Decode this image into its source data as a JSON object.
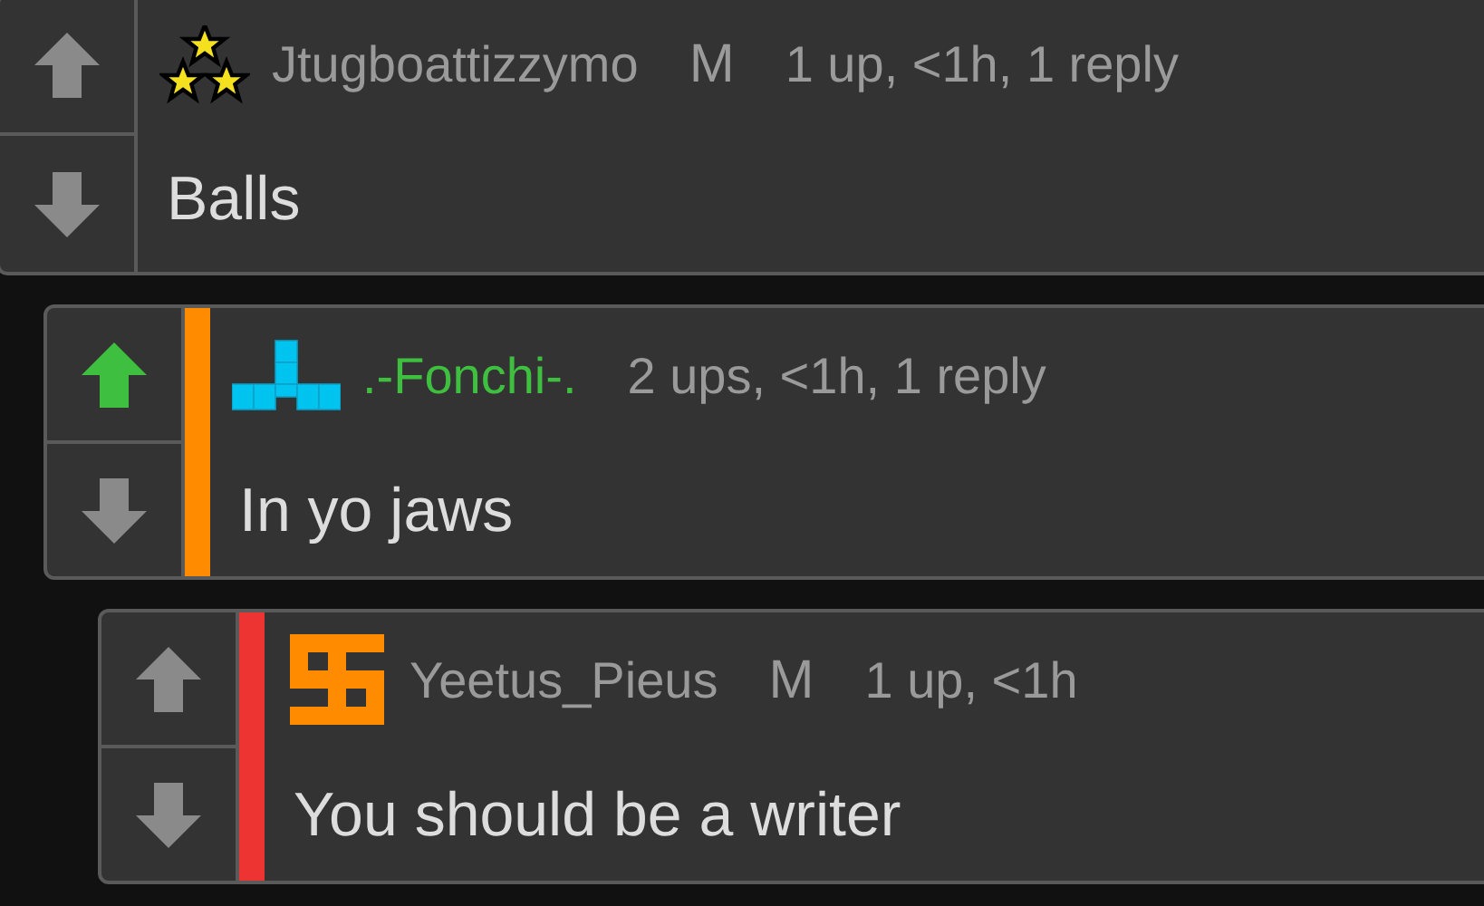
{
  "comments": [
    {
      "user": "Jtugboattizzymo",
      "user_highlighted": false,
      "mod_badge": "M",
      "meta": "1 up, <1h, 1 reply",
      "body": "Balls",
      "upvoted": false,
      "downvoted": false,
      "children": [
        {
          "user": ".-Fonchi-.",
          "user_highlighted": true,
          "meta": "2 ups, <1h, 1 reply",
          "body": "In yo jaws",
          "upvoted": true,
          "downvoted": false,
          "color": "#ff8c00",
          "children": [
            {
              "user": "Yeetus_Pieus",
              "user_highlighted": false,
              "mod_badge": "M",
              "meta": "1 up, <1h",
              "body": "You should be a writer",
              "upvoted": false,
              "downvoted": false,
              "color": "#ee3333"
            }
          ]
        }
      ]
    }
  ]
}
